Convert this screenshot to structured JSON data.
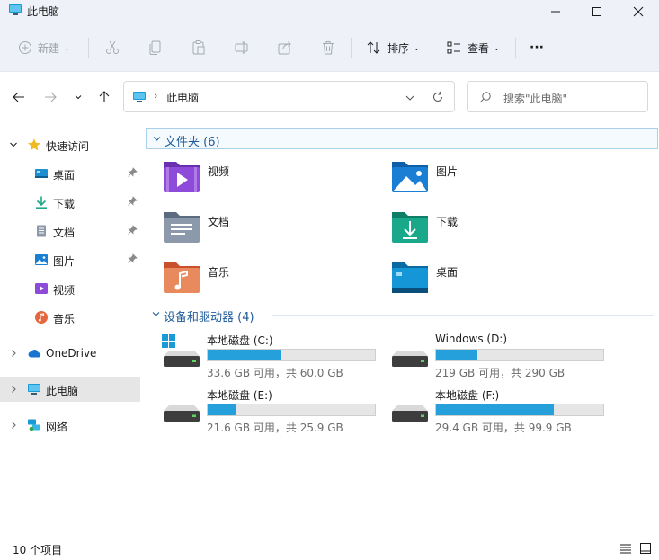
{
  "window": {
    "title": "此电脑"
  },
  "toolbar": {
    "new_label": "新建",
    "sort_label": "排序",
    "view_label": "查看",
    "more_label": "···"
  },
  "address": {
    "location": "此电脑",
    "separator": "›"
  },
  "search": {
    "placeholder": "搜索\"此电脑\""
  },
  "sidebar": {
    "quick_access": "快速访问",
    "pinned": [
      {
        "label": "桌面",
        "icon": "desktop-icon"
      },
      {
        "label": "下载",
        "icon": "download-icon"
      },
      {
        "label": "文档",
        "icon": "document-icon"
      },
      {
        "label": "图片",
        "icon": "picture-icon"
      }
    ],
    "recent": [
      {
        "label": "视频",
        "icon": "video-icon"
      },
      {
        "label": "音乐",
        "icon": "music-icon"
      }
    ],
    "onedrive": "OneDrive",
    "this_pc": "此电脑",
    "network": "网络"
  },
  "folders_section": {
    "title": "文件夹 (6)"
  },
  "folders": [
    {
      "name": "视频",
      "icon": "video-folder-icon",
      "color": "#8e4bd9"
    },
    {
      "name": "图片",
      "icon": "pictures-folder-icon",
      "color": "#1a7fd4"
    },
    {
      "name": "文档",
      "icon": "documents-folder-icon",
      "color": "#7b8ea6"
    },
    {
      "name": "下载",
      "icon": "downloads-folder-icon",
      "color": "#1aa88a"
    },
    {
      "name": "音乐",
      "icon": "music-folder-icon",
      "color": "#e0763f"
    },
    {
      "name": "桌面",
      "icon": "desktop-folder-icon",
      "color": "#1596d6"
    }
  ],
  "drives_section": {
    "title": "设备和驱动器 (4)"
  },
  "drives": [
    {
      "name": "本地磁盘 (C:)",
      "size_text": "33.6 GB 可用，共 60.0 GB",
      "used_fraction": 0.44,
      "system": true
    },
    {
      "name": "Windows (D:)",
      "size_text": "219 GB 可用，共 290 GB",
      "used_fraction": 0.245,
      "system": false
    },
    {
      "name": "本地磁盘 (E:)",
      "size_text": "21.6 GB 可用，共 25.9 GB",
      "used_fraction": 0.166,
      "system": false
    },
    {
      "name": "本地磁盘 (F:)",
      "size_text": "29.4 GB 可用，共 99.9 GB",
      "used_fraction": 0.706,
      "system": false
    }
  ],
  "status": {
    "item_count": "10 个项目"
  },
  "colors": {
    "accent": "#26a0da",
    "chrome": "#eef1f7",
    "selection": "#e6e6e6"
  }
}
